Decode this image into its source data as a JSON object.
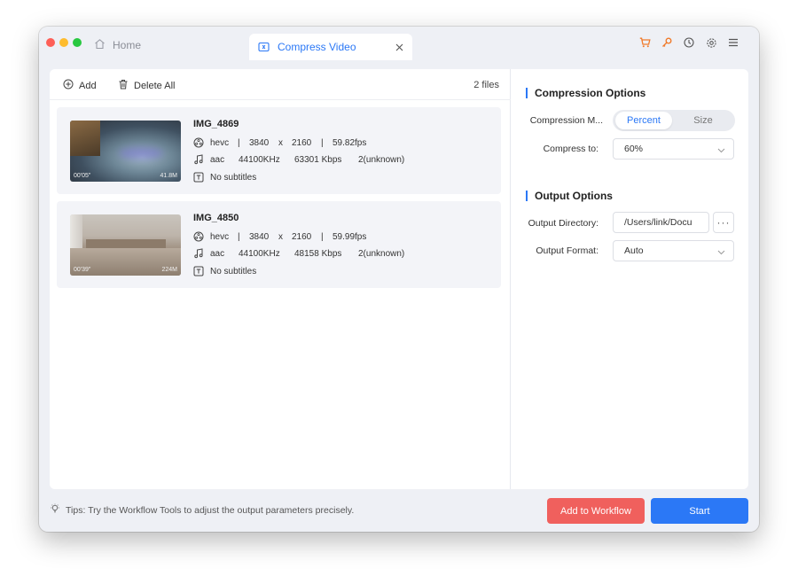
{
  "window": {
    "tabs": [
      {
        "label": "Home",
        "icon": "home-icon",
        "active": false
      },
      {
        "label": "Compress Video",
        "icon": "compress-video-icon",
        "active": true
      }
    ],
    "toolbar_icons": [
      "cart-icon",
      "key-icon",
      "history-icon",
      "settings-icon",
      "menu-icon"
    ],
    "colors": {
      "accent": "#2b78f6",
      "danger": "#f0605d",
      "cart": "#f07a2a"
    }
  },
  "list": {
    "add_label": "Add",
    "delete_all_label": "Delete All",
    "file_count": "2 files",
    "files": [
      {
        "name": "IMG_4869",
        "duration": "00'05\"",
        "size": "41.8M",
        "video": {
          "codec": "hevc",
          "sep1": "|",
          "width": "3840",
          "x": "x",
          "height": "2160",
          "sep2": "|",
          "fps": "59.82fps"
        },
        "audio": {
          "codec": "aac",
          "rate": "44100KHz",
          "bitrate": "63301 Kbps",
          "channels": "2(unknown)"
        },
        "subtitles": "No subtitles"
      },
      {
        "name": "IMG_4850",
        "duration": "00'39\"",
        "size": "224M",
        "video": {
          "codec": "hevc",
          "sep1": "|",
          "width": "3840",
          "x": "x",
          "height": "2160",
          "sep2": "|",
          "fps": "59.99fps"
        },
        "audio": {
          "codec": "aac",
          "rate": "44100KHz",
          "bitrate": "48158 Kbps",
          "channels": "2(unknown)"
        },
        "subtitles": "No subtitles"
      }
    ]
  },
  "options": {
    "compression_title": "Compression Options",
    "compression_mode_label": "Compression M...",
    "mode_options": [
      "Percent",
      "Size"
    ],
    "mode_selected": "Percent",
    "compress_to_label": "Compress to:",
    "compress_to_value": "60%",
    "output_title": "Output Options",
    "output_dir_label": "Output Directory:",
    "output_dir_value": "/Users/link/Docu",
    "output_dir_more": "···",
    "output_format_label": "Output Format:",
    "output_format_value": "Auto"
  },
  "footer": {
    "tips": "Tips: Try the Workflow Tools to adjust the output parameters precisely.",
    "add_to_workflow": "Add to Workflow",
    "start": "Start"
  }
}
